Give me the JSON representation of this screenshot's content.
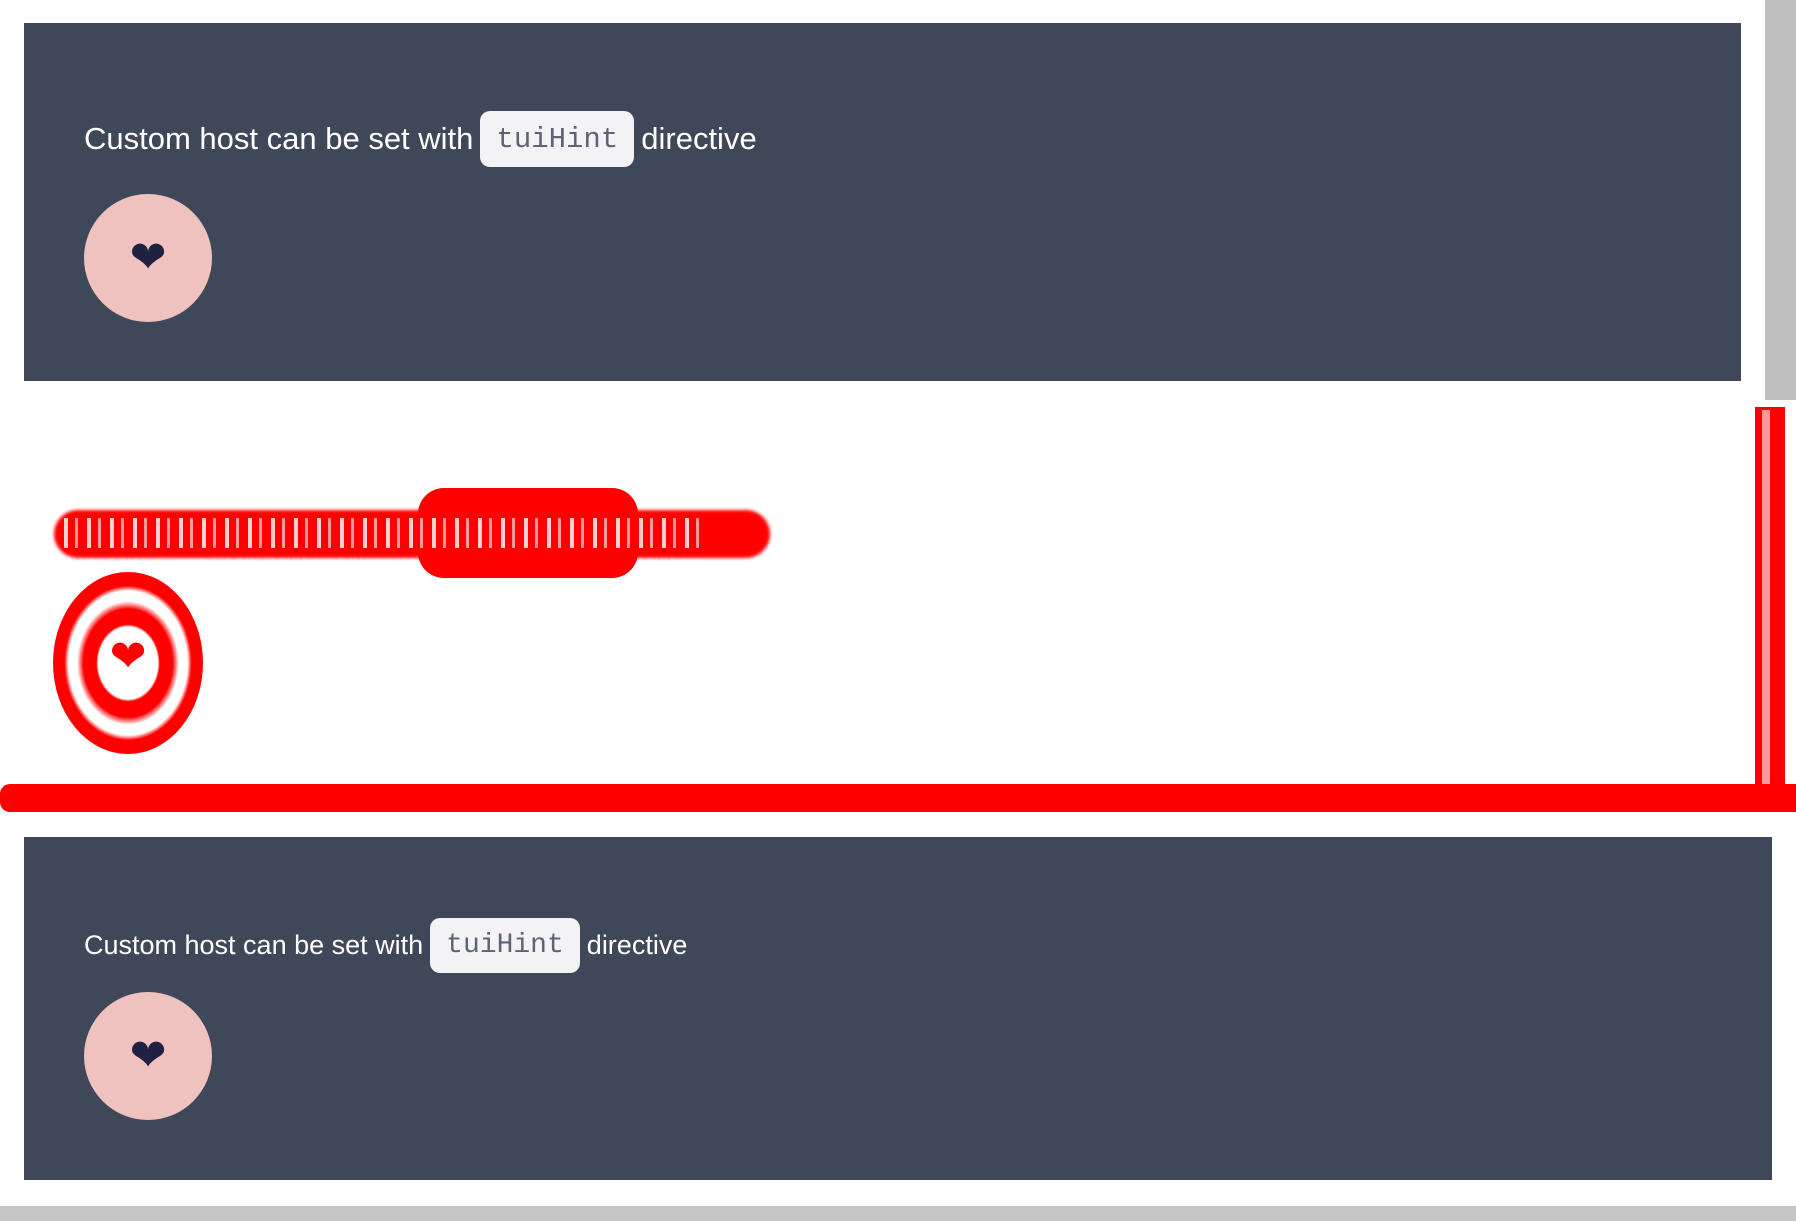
{
  "sections": [
    {
      "text_before": "Custom host can be set with",
      "code": "tuiHint",
      "text_after": "directive",
      "button_icon": "heart-icon"
    },
    {
      "text_before": "Custom host can be set with",
      "code": "tuiHint",
      "text_after": "directive",
      "button_icon": "heart-icon"
    }
  ],
  "glyphs": {
    "heart": "❤"
  },
  "colors": {
    "panel": "#3f4859",
    "chip_bg": "#f3f3f5",
    "heart_button": "#efc1bf",
    "heart_icon": "#1e2240",
    "diff": "#ff0000"
  }
}
